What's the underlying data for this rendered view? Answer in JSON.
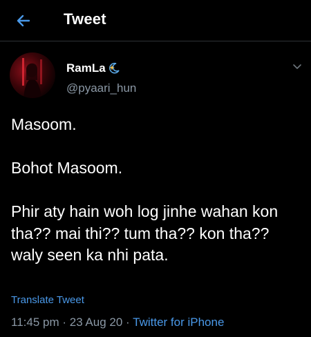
{
  "header": {
    "title": "Tweet"
  },
  "tweet": {
    "display_name": "RamLa",
    "handle": "@pyaari_hun",
    "text": "Masoom.\n\nBohot Masoom.\n\nPhir aty hain woh log jinhe wahan kon tha?? mai thi?? tum tha?? kon tha?? waly seen ka nhi pata.",
    "translate_label": "Translate Tweet",
    "time": "11:45 pm",
    "separator": " · ",
    "date": "23 Aug 20",
    "source": "Twitter for iPhone"
  },
  "icons": {
    "back": "arrow-left-icon",
    "caret": "chevron-down-icon",
    "name_emoji": "sparkle-moon-emoji"
  },
  "colors": {
    "background": "#000000",
    "accent": "#4a99e9",
    "secondary_text": "#8b98a5",
    "divider": "#2f3336"
  }
}
